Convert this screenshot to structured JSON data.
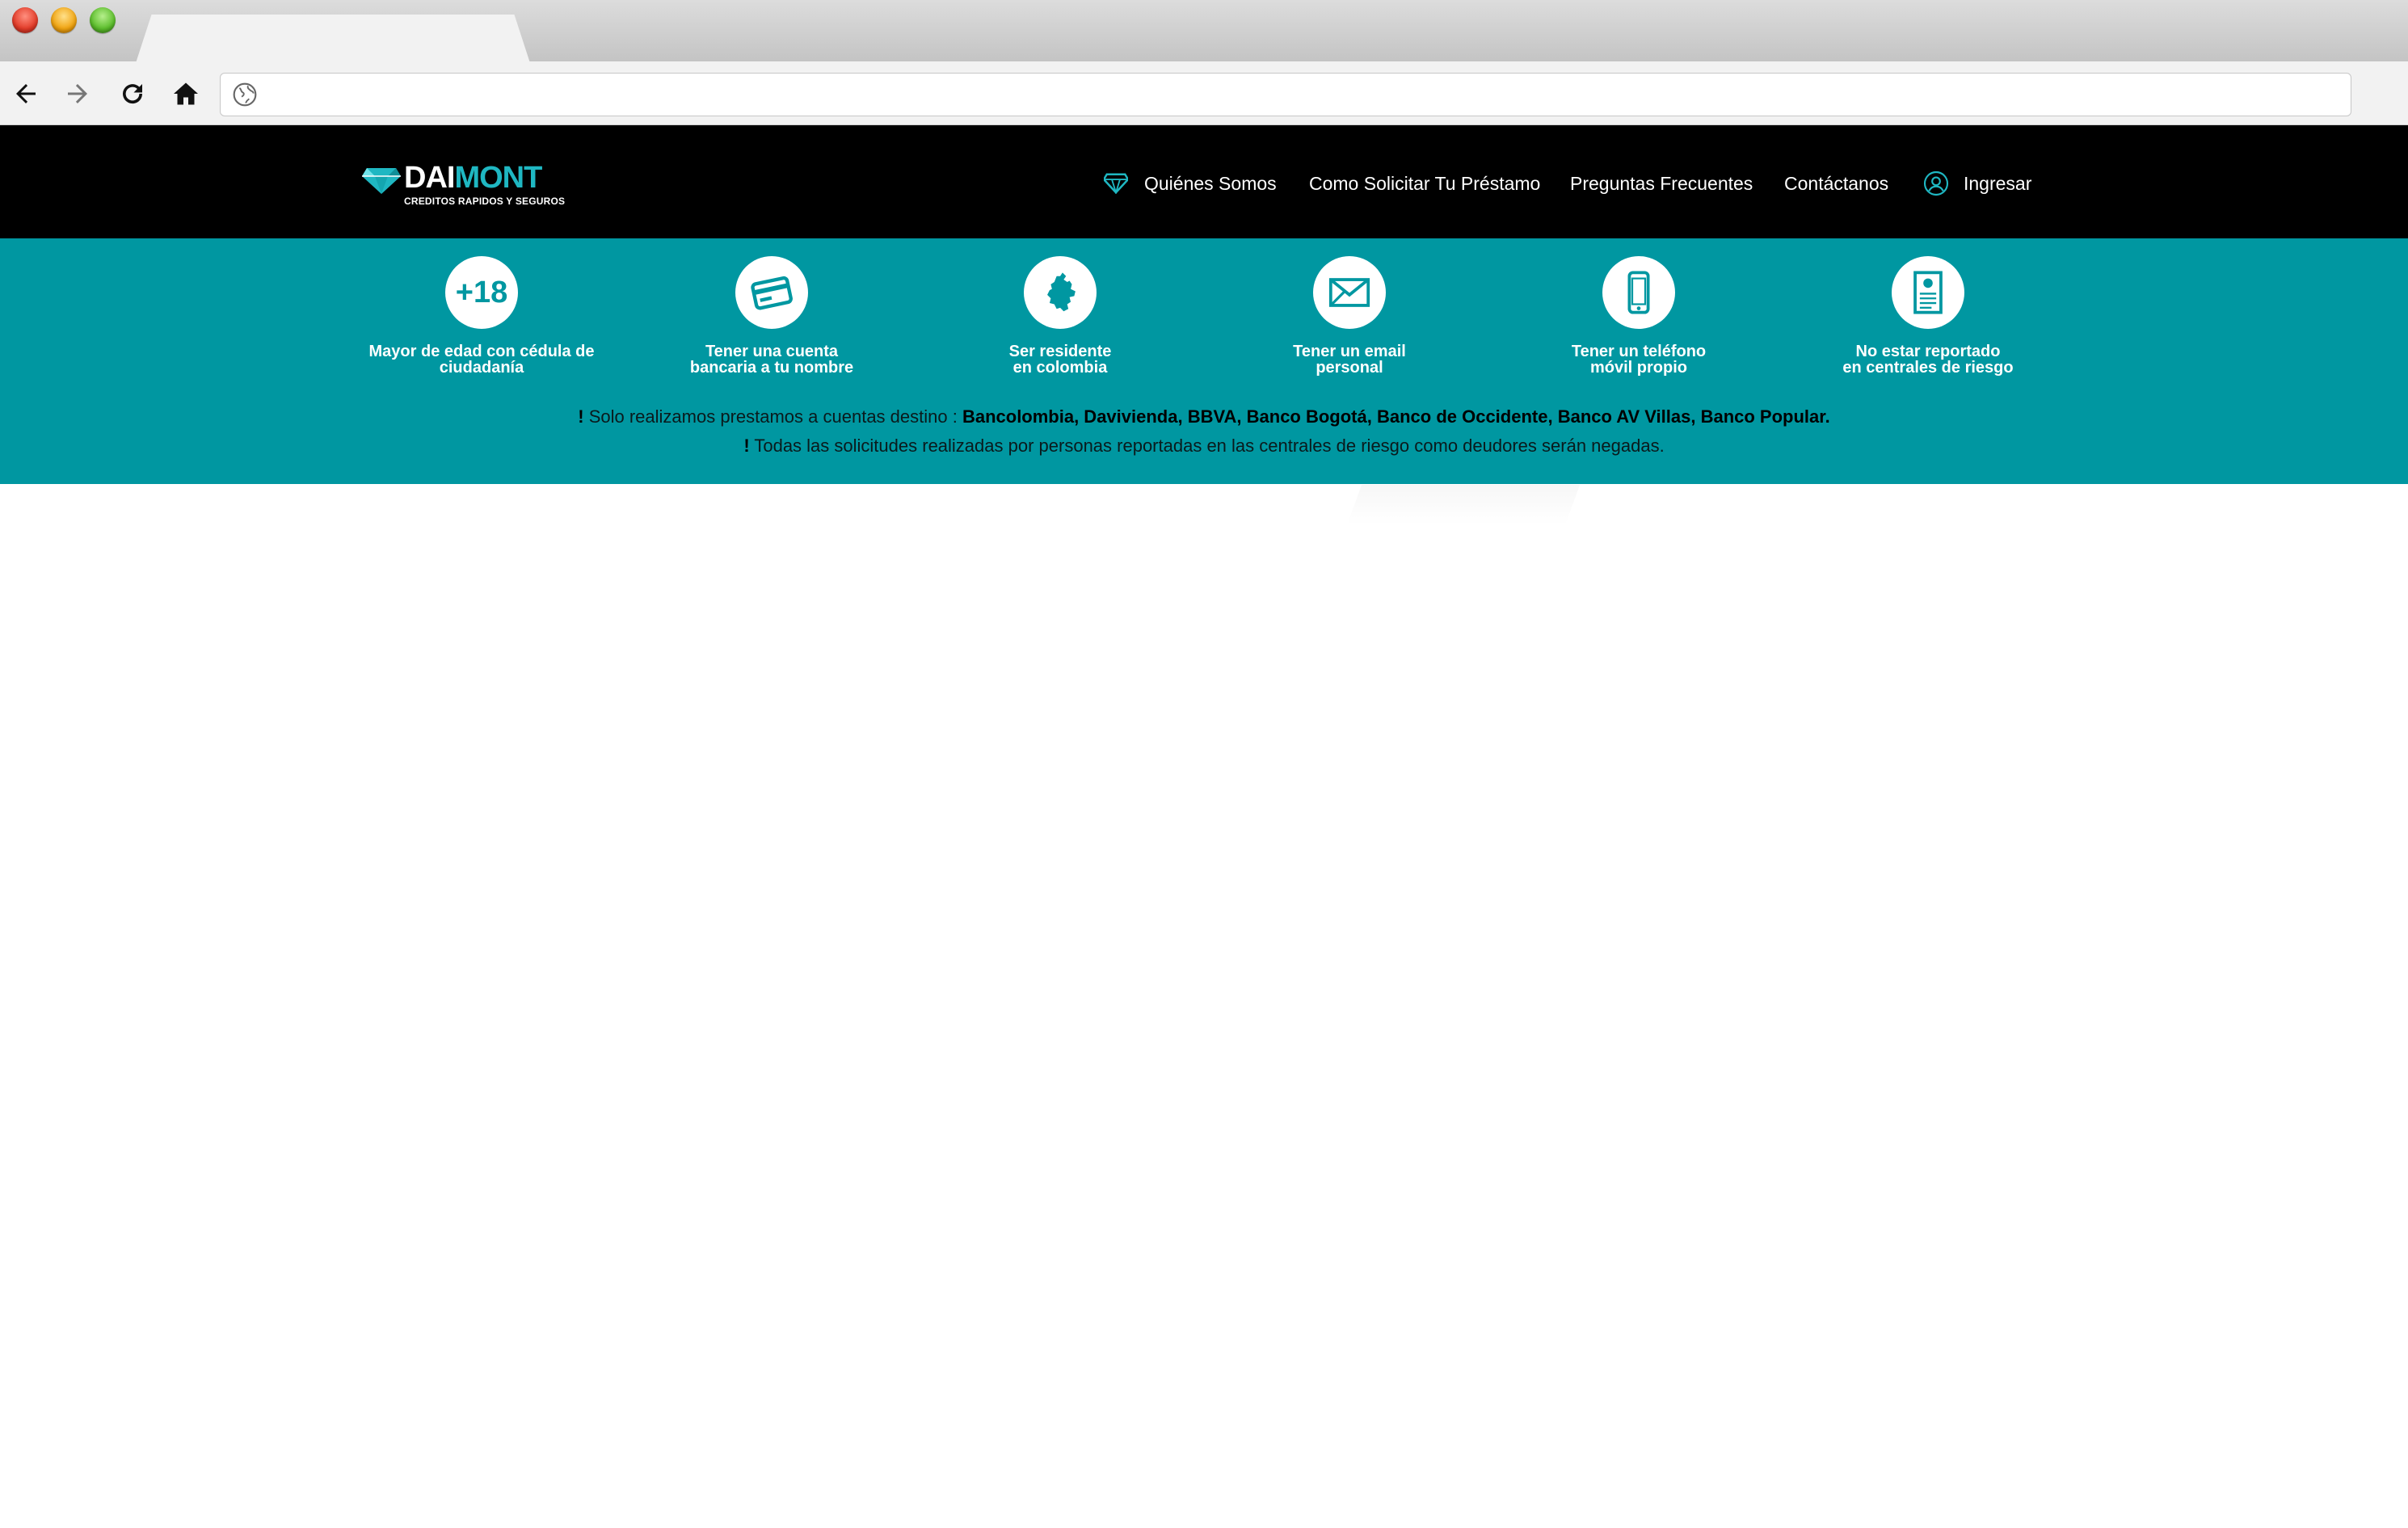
{
  "browser": {
    "address_value": ""
  },
  "header": {
    "logo": {
      "word_white": "DAI",
      "word_teal": "MONT",
      "tagline": "CREDITOS RAPIDOS Y SEGUROS"
    },
    "nav": [
      {
        "label": "Quiénes Somos",
        "icon": "diamond-icon"
      },
      {
        "label": "Como Solicitar Tu Préstamo"
      },
      {
        "label": "Preguntas Frecuentes"
      },
      {
        "label": "Contáctanos"
      },
      {
        "label": "Ingresar",
        "icon": "user-icon"
      }
    ]
  },
  "requirements": [
    {
      "icon": "plus-18-icon",
      "badge": "+18",
      "label": "Mayor de edad con cédula de\nciudadanía"
    },
    {
      "icon": "credit-card-icon",
      "label": "Tener una cuenta\nbancaria a tu nombre"
    },
    {
      "icon": "colombia-map-icon",
      "label": "Ser residente\nen colombia"
    },
    {
      "icon": "envelope-icon",
      "label": "Tener un email\npersonal"
    },
    {
      "icon": "mobile-phone-icon",
      "label": "Tener un teléfono\nmóvil propio"
    },
    {
      "icon": "report-document-icon",
      "label": "No estar reportado\nen centrales de riesgo"
    }
  ],
  "notes": {
    "bang": "!",
    "line1_prefix": " Solo realizamos prestamos a cuentas destino : ",
    "line1_banks": "Bancolombia, Davivienda, BBVA, Banco Bogotá, Banco de Occidente, Banco AV Villas, Banco Popular.",
    "line2": " Todas las solicitudes realizadas por personas reportadas en las centrales de riesgo como deudores serán negadas."
  },
  "colors": {
    "header_bg": "#000000",
    "band_bg": "#0097a1",
    "brand_teal": "#1fb7c2"
  }
}
